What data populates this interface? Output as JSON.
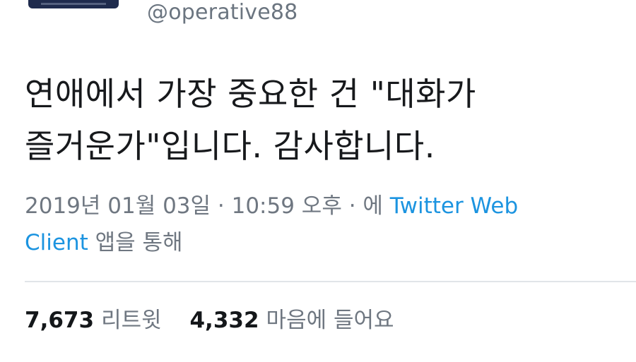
{
  "user": {
    "handle": "@operative88"
  },
  "tweet": {
    "text_line1": "연애에서 가장 중요한 건 \"대화가",
    "text_line2": "즐거운가\"입니다. 감사합니다."
  },
  "meta": {
    "datetime": "2019년 01월 03일 · 10:59 오후 · 에 ",
    "client_part1": "Twitter Web",
    "client_part2": "Client",
    "suffix": " 앱을 통해"
  },
  "stats": {
    "retweets_count": "7,673",
    "retweets_label": "리트윗",
    "likes_count": "4,332",
    "likes_label": "마음에 들어요"
  },
  "colors": {
    "link": "#1c94e0",
    "muted": "#6f7781",
    "text": "#17191c"
  }
}
